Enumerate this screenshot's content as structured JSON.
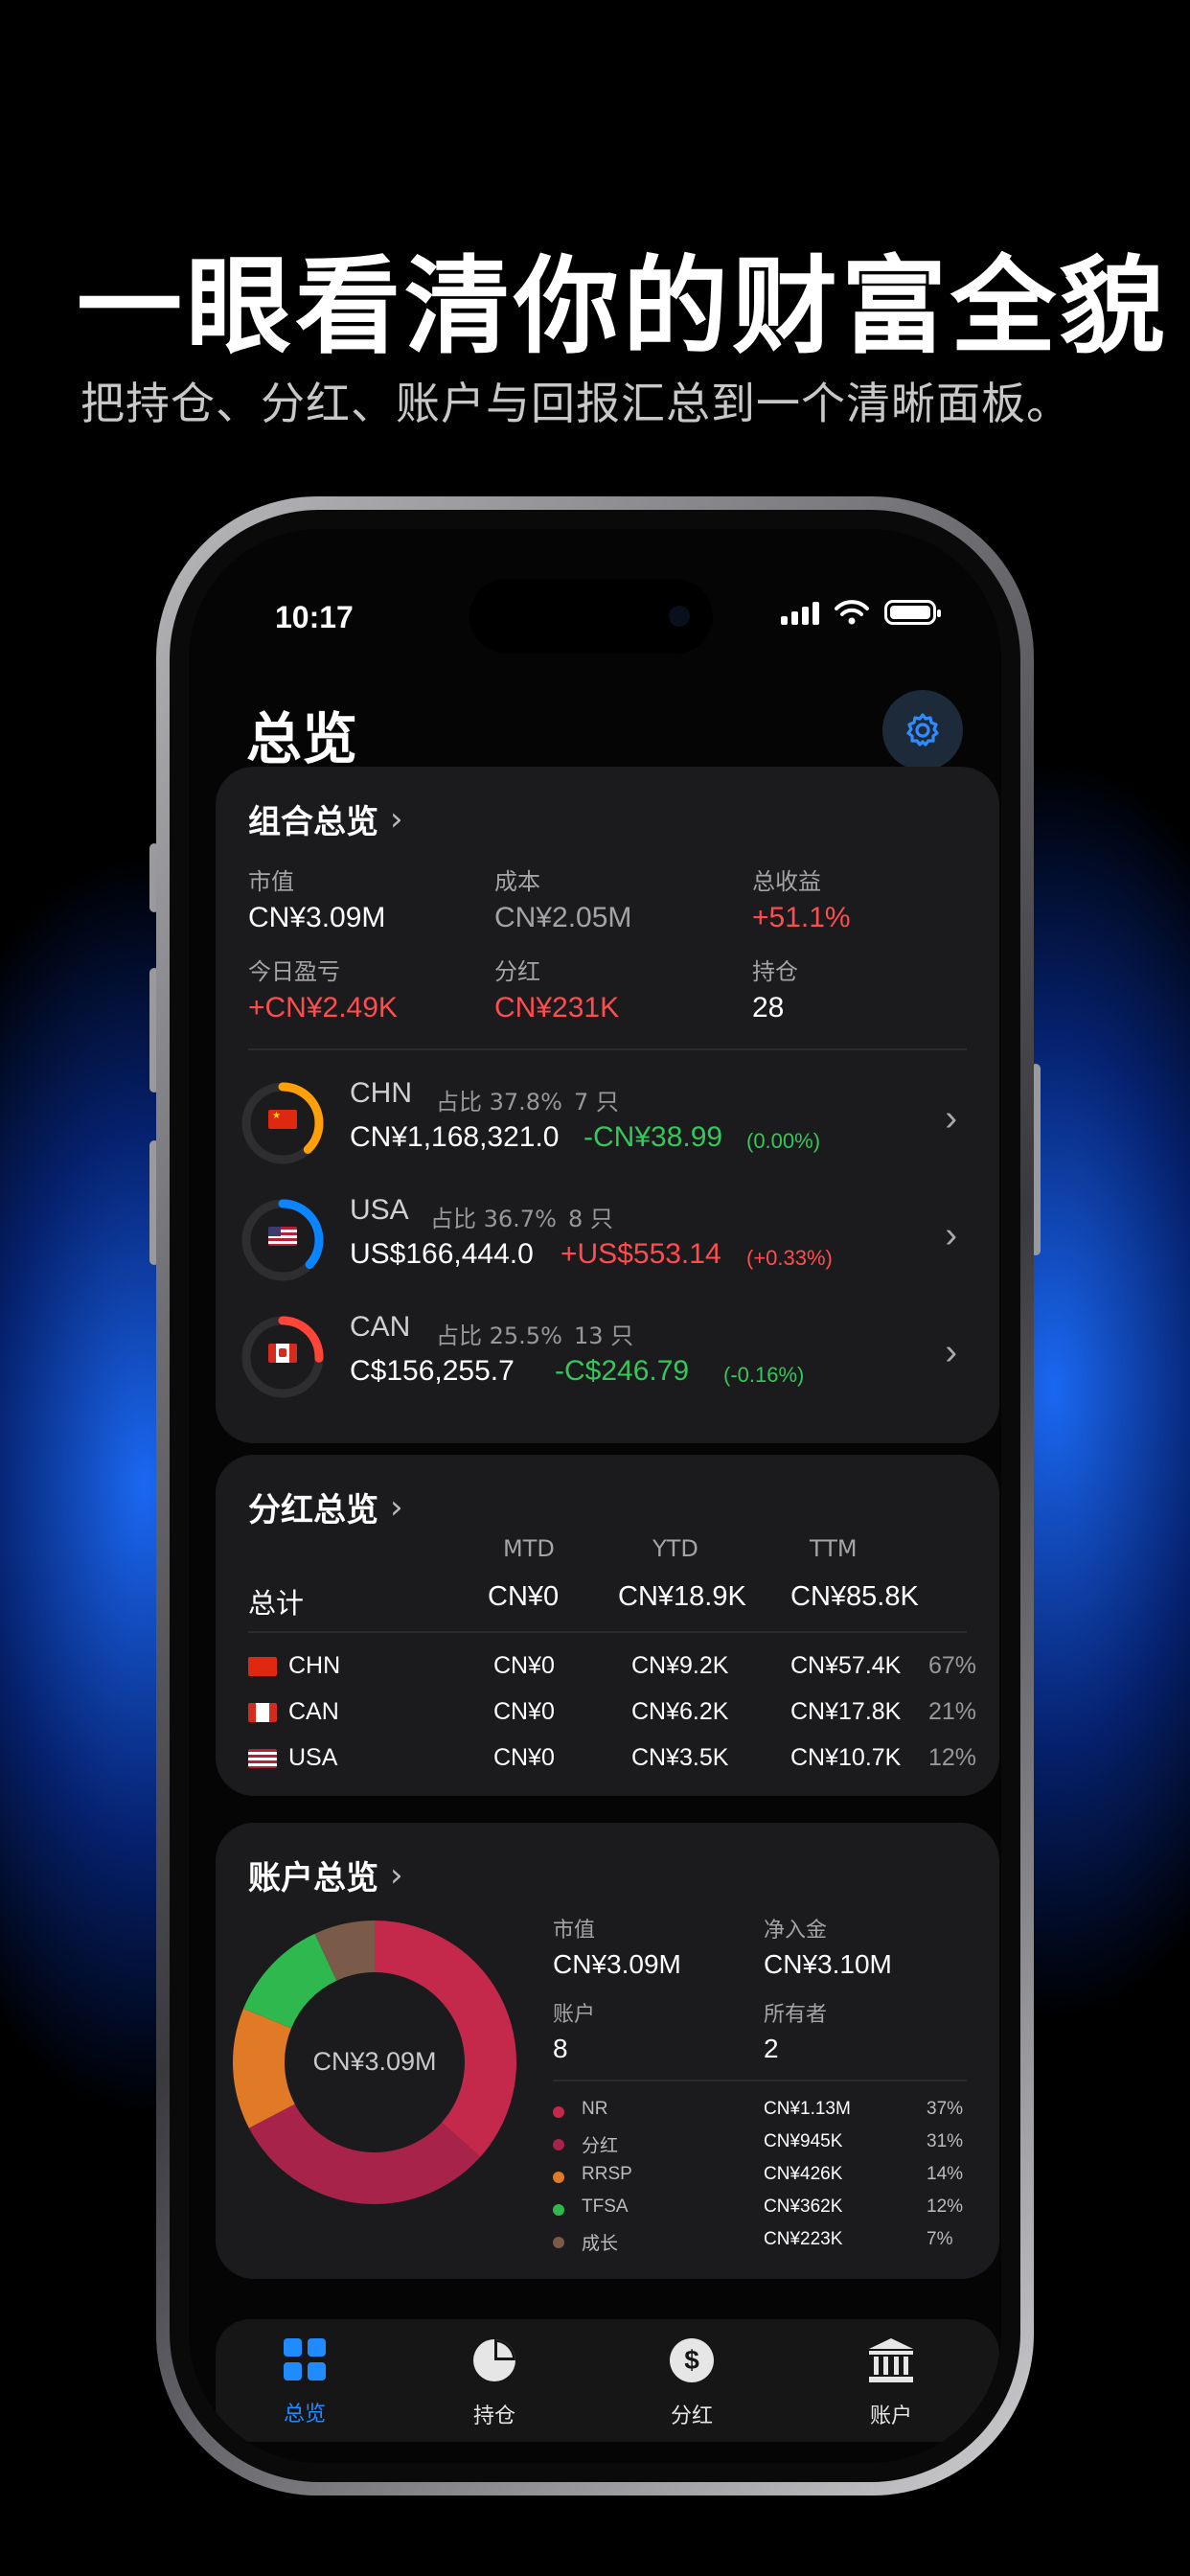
{
  "promo": {
    "headline": "一眼看清你的财富全貌",
    "subline": "把持仓、分红、账户与回报汇总到一个清晰面板。"
  },
  "status_bar": {
    "time": "10:17"
  },
  "header": {
    "title": "总览",
    "settings_icon": "gear-icon"
  },
  "portfolio": {
    "title": "组合总览",
    "metrics": [
      {
        "label": "市值",
        "value": "CN¥3.09M",
        "color": "#ffffff"
      },
      {
        "label": "成本",
        "value": "CN¥2.05M",
        "color": "#a4a4a6"
      },
      {
        "label": "总收益",
        "value": "+51.1%",
        "color": "#ff4d4f"
      },
      {
        "label": "今日盈亏",
        "value": "+CN¥2.49K",
        "color": "#ff4d4f"
      },
      {
        "label": "分红",
        "value": "CN¥231K",
        "color": "#ff4d4f"
      },
      {
        "label": "持仓",
        "value": "28",
        "color": "#ffffff"
      }
    ],
    "regions": [
      {
        "code": "CHN",
        "share_label": "占比 37.8%",
        "count": "7 只",
        "value": "CN¥1,168,321.0",
        "change": "-CN¥38.99",
        "pct": "(0.00%)",
        "trend": "down",
        "ring_color": "#ff9f0a",
        "ring_pct": 0.378
      },
      {
        "code": "USA",
        "share_label": "占比 36.7%",
        "count": "8 只",
        "value": "US$166,444.0",
        "change": "+US$553.14",
        "pct": "(+0.33%)",
        "trend": "up",
        "ring_color": "#0a84ff",
        "ring_pct": 0.367
      },
      {
        "code": "CAN",
        "share_label": "占比 25.5%",
        "count": "13 只",
        "value": "C$156,255.7",
        "change": "-C$246.79",
        "pct": "(-0.16%)",
        "trend": "down",
        "ring_color": "#ff453a",
        "ring_pct": 0.255
      }
    ]
  },
  "dividends": {
    "title": "分红总览",
    "columns": [
      "MTD",
      "YTD",
      "TTM"
    ],
    "total": {
      "label": "总计",
      "mtd": "CN¥0",
      "ytd": "CN¥18.9K",
      "ttm": "CN¥85.8K"
    },
    "rows": [
      {
        "country": "CHN",
        "mtd": "CN¥0",
        "ytd": "CN¥9.2K",
        "ttm": "CN¥57.4K",
        "share": "67%"
      },
      {
        "country": "CAN",
        "mtd": "CN¥0",
        "ytd": "CN¥6.2K",
        "ttm": "CN¥17.8K",
        "share": "21%"
      },
      {
        "country": "USA",
        "mtd": "CN¥0",
        "ytd": "CN¥3.5K",
        "ttm": "CN¥10.7K",
        "share": "12%"
      }
    ]
  },
  "accounts": {
    "title": "账户总览",
    "donut_center": "CN¥3.09M",
    "stats": [
      {
        "label": "市值",
        "value": "CN¥3.09M"
      },
      {
        "label": "净入金",
        "value": "CN¥3.10M"
      },
      {
        "label": "账户",
        "value": "8"
      },
      {
        "label": "所有者",
        "value": "2"
      }
    ],
    "legend": [
      {
        "name": "NR",
        "value": "CN¥1.13M",
        "pct": "37%",
        "color": "#c4294b"
      },
      {
        "name": "分红",
        "value": "CN¥945K",
        "pct": "31%",
        "color": "#a8234a"
      },
      {
        "name": "RRSP",
        "value": "CN¥426K",
        "pct": "14%",
        "color": "#e07a26"
      },
      {
        "name": "TFSA",
        "value": "CN¥362K",
        "pct": "12%",
        "color": "#2eb84d"
      },
      {
        "name": "成长",
        "value": "CN¥223K",
        "pct": "7%",
        "color": "#7a5a48"
      }
    ],
    "slices": [
      0.37,
      0.31,
      0.14,
      0.12,
      0.07
    ]
  },
  "tabbar": {
    "tabs": [
      {
        "label": "总览",
        "icon": "grid-icon",
        "active": true
      },
      {
        "label": "持仓",
        "icon": "pie-icon",
        "active": false
      },
      {
        "label": "分红",
        "icon": "dollar-icon",
        "active": false
      },
      {
        "label": "账户",
        "icon": "bank-icon",
        "active": false
      }
    ]
  },
  "colors": {
    "accent": "#0a84ff",
    "gain": "#ff4d4f",
    "loss": "#34c759"
  }
}
